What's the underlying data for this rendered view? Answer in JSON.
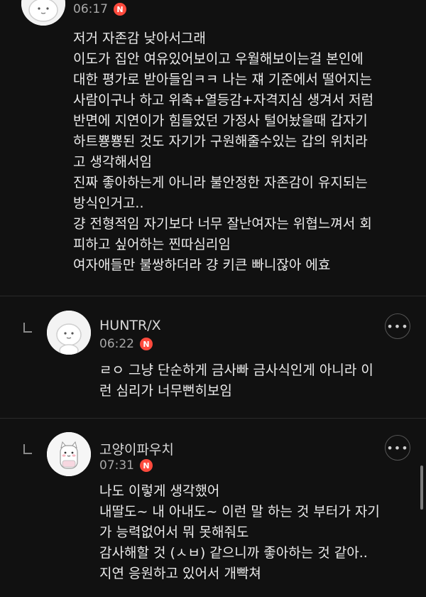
{
  "comments": [
    {
      "time": "06:17",
      "badge": "N",
      "lines": [
        "저거 자존감 낮아서그래",
        "이도가 집안 여유있어보이고 우월해보이는걸 본인에",
        "대한 평가로 받아들임ㅋㅋ 나는 쟤 기준에서 떨어지는",
        "사람이구나 하고 위축+열등감+자격지심 생겨서 저럼",
        "반면에 지연이가 힘들었던 가정사 털어놨을때 갑자기",
        "하트뿅뿅된 것도 자기가 구원해줄수있는 갑의 위치라",
        "고 생각해서임",
        "진짜 좋아하는게 아니라 불안정한 자존감이 유지되는",
        "방식인거고..",
        "걍 전형적임 자기보다 너무 잘난여자는 위협느껴서 회",
        "피하고 싶어하는 찐따심리임",
        "여자애들만 불쌍하더라 걍 키큰 빠니잖아 에효"
      ]
    },
    {
      "name": "HUNTR/X",
      "time": "06:22",
      "badge": "N",
      "lines": [
        "ㄹㅇ 그냥 단순하게 금사빠 금사식인게 아니라 이",
        "런 심리가 너무뻔히보임"
      ]
    },
    {
      "name": "고양이파우치",
      "time": "07:31",
      "badge": "N",
      "lines": [
        "나도 이렇게 생각했어",
        "내딸도~ 내 아내도~ 이런 말 하는 것 부터가 자기",
        "가 능력없어서 뭐 못해줘도",
        "감사해할 것 (ㅅㅂ) 같으니까 좋아하는 것 같아..",
        "지연 응원하고 있어서 개빡쳐"
      ]
    }
  ],
  "more_label": "•••"
}
